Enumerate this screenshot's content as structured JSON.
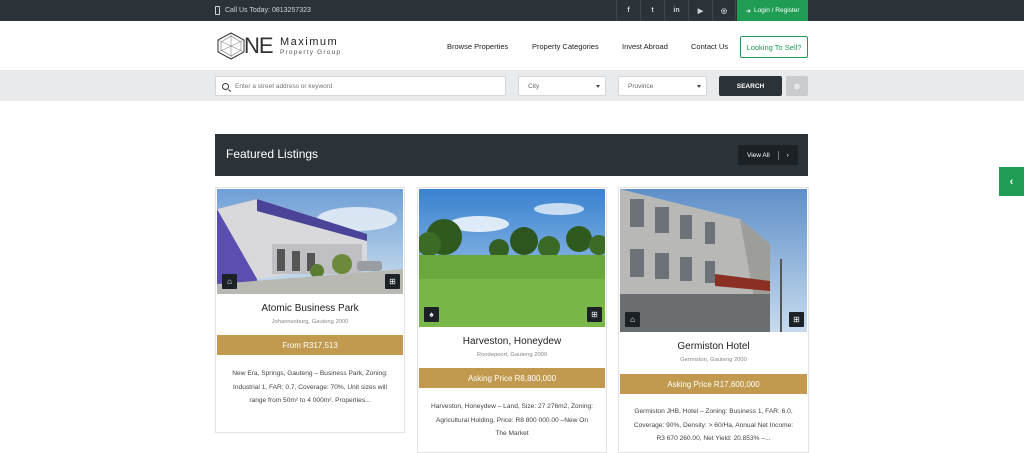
{
  "topbar": {
    "call_text": "Call Us Today: 0813257323",
    "socials": [
      {
        "icon": "facebook-icon",
        "glyph": "f"
      },
      {
        "icon": "twitter-icon",
        "glyph": "t"
      },
      {
        "icon": "linkedin-icon",
        "glyph": "in"
      },
      {
        "icon": "youtube-icon",
        "glyph": "▶"
      },
      {
        "icon": "instagram-icon",
        "glyph": "◎"
      }
    ],
    "login_label": "Login / Register"
  },
  "header": {
    "logo": {
      "mark": "NE",
      "word": "Maximum",
      "sub": "Property Group"
    },
    "nav": [
      "Browse Properties",
      "Property Categories",
      "Invest Abroad",
      "Contact Us"
    ],
    "sell_label": "Looking To Sell?"
  },
  "search": {
    "placeholder": "Enter a street address or keyword",
    "city": "City",
    "province": "Province",
    "button": "SEARCH"
  },
  "featured": {
    "title": "Featured Listings",
    "view_all": "View All"
  },
  "listings": [
    {
      "name": "Atomic Business Park",
      "location": "Johannesburg, Gauteng 2000",
      "price": "From R317,513",
      "description": "New Era, Springs, Gauteng – Business Park, Zoning: Industrial 1, FAR: 0.7, Coverage: 70%, Unit sizes will range from 50m² to 4 000m². Properties..."
    },
    {
      "name": "Harveston, Honeydew",
      "location": "Roodepoort, Gauteng 2000",
      "price": "Asking Price R8,800,000",
      "description": "Harveston, Honeydew – Land, Size: 27 276m2, Zoning: Agricultural Holding, Price: R8 800 000.00 –New On The Market"
    },
    {
      "name": "Germiston Hotel",
      "location": "Germiston, Gauteng 2000",
      "price": "Asking Price R17,600,000",
      "description": "Germiston JHB, Hotel – Zoning: Business 1, FAR: 6.0, Coverage: 90%, Density: > 60/Ha, Annual Net Income: R3 670 260.00, Net Yield: 20.853% –..."
    }
  ],
  "colors": {
    "dark": "#2c3338",
    "green": "#1f9d55",
    "gold": "#c29a4f"
  }
}
